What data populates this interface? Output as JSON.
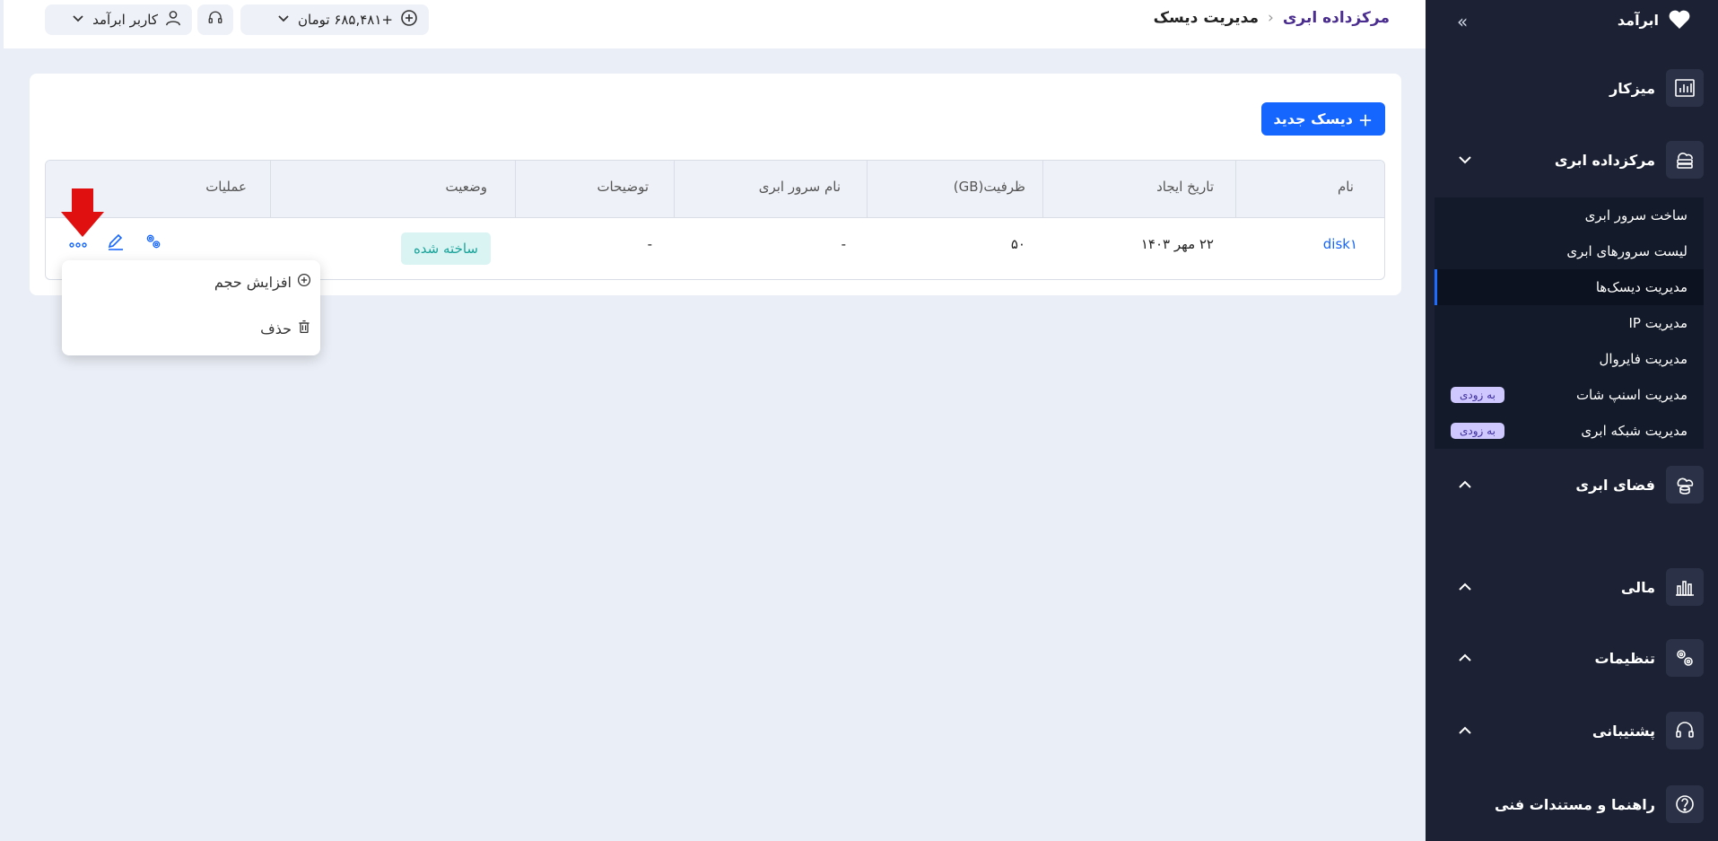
{
  "sidebar": {
    "brand": "ابرآمد",
    "items": [
      {
        "label": "میزکار",
        "icon": "dashboard-chart-icon"
      },
      {
        "label": "مرکزداده ابری",
        "icon": "cloud-server-icon"
      },
      {
        "label": "فضای ابری",
        "icon": "cloud-storage-icon"
      },
      {
        "label": "مالی",
        "icon": "finance-chart-icon"
      },
      {
        "label": "تنظیمات",
        "icon": "settings-gears-icon"
      },
      {
        "label": "پشتیبانی",
        "icon": "headset-icon"
      },
      {
        "label": "راهنما و مستندات فنی",
        "icon": "help-icon"
      }
    ],
    "submenu": [
      {
        "label": "ساخت سرور ابری"
      },
      {
        "label": "لیست سرورهای ابری"
      },
      {
        "label": "مدیریت دیسک‌ها",
        "active": true
      },
      {
        "label": "مدیریت IP"
      },
      {
        "label": "مدیریت فایروال"
      },
      {
        "label": "مدیریت اسنپ شات",
        "badge": "به زودی"
      },
      {
        "label": "مدیریت شبکه ابری",
        "badge": "به زودی"
      }
    ]
  },
  "topbar": {
    "breadcrumb_parent": "مرکزداده ابری",
    "breadcrumb_current": "مدیریت دیسک",
    "balance": "+۶۸۵,۴۸۱ تومان",
    "user": "کاربر ابرآمد"
  },
  "card": {
    "new_disk_label": "دیسک جدید",
    "columns": [
      "نام",
      "تاریخ ایجاد",
      "ظرفیت(GB)",
      "نام سرور ابری",
      "توضیحات",
      "وضعیت",
      "عملیات"
    ],
    "row": {
      "name": "disk۱",
      "created": "۲۲ مهر ۱۴۰۳",
      "capacity": "۵۰",
      "server": "-",
      "description": "-",
      "status": "ساخته شده"
    }
  },
  "dropdown": {
    "items": [
      {
        "label": "افزایش حجم",
        "icon": "plus-circle-icon"
      },
      {
        "label": "حذف",
        "icon": "trash-icon"
      }
    ]
  },
  "colors": {
    "primary": "#1565ff",
    "sidebar_bg": "#1c2233",
    "status_bg": "#d9f4f3",
    "status_text": "#1aa39a",
    "arrow": "#e01010"
  }
}
